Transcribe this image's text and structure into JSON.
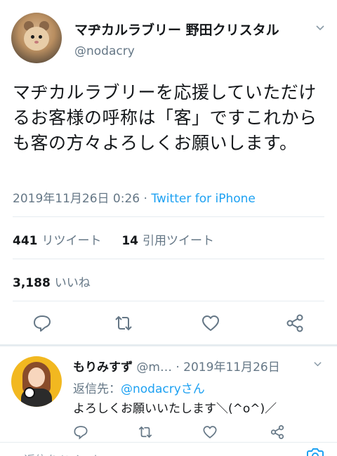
{
  "tweet": {
    "display_name": "マヂカルラブリー 野田クリスタル",
    "handle": "@nodacry",
    "text": "マヂカルラブリーを応援していただけるお客様の呼称は「客」ですこれからも客の方々よろしくお願いします。",
    "timestamp": "2019年11月26日 0:26 · ",
    "source": "Twitter for iPhone",
    "retweets_count": "441",
    "retweets_label": "リツイート",
    "quotes_count": "14",
    "quotes_label": "引用ツイート",
    "likes_count": "3,188",
    "likes_label": "いいね",
    "actions": [
      "reply-icon",
      "retweet-icon",
      "like-icon",
      "share-icon"
    ]
  },
  "reply": {
    "display_name": "もりみすず",
    "handle_and_date": " @m… · 2019年11月26日",
    "reply_to_label": "返信先：",
    "reply_to_handle": "@nodacryさん",
    "text": "よろしくお願いいたします＼(^o^)／"
  },
  "composer": {
    "placeholder": "返信をツイート"
  },
  "colors": {
    "link": "#1da1f2",
    "secondary_text": "#657786",
    "divider": "#e6ecf0"
  }
}
